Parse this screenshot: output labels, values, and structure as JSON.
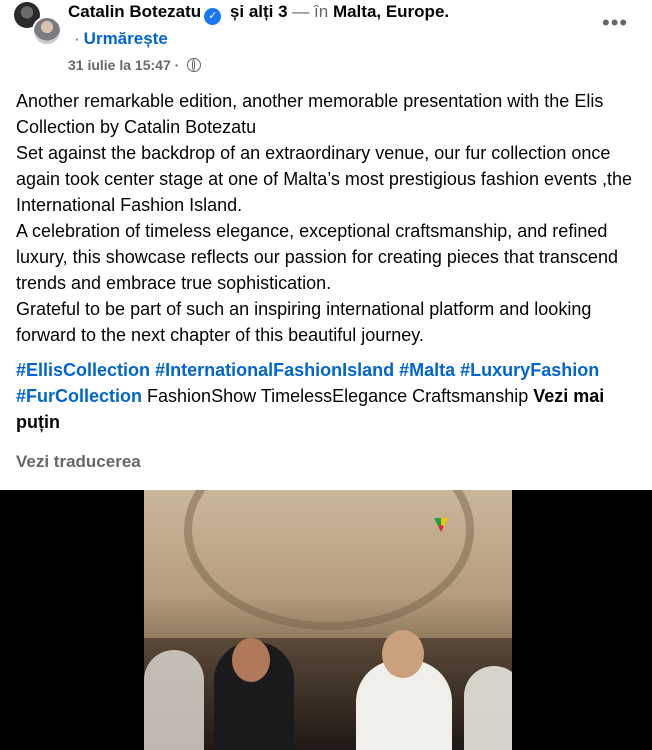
{
  "post": {
    "author": "Catalin Botezatu",
    "coauthors": "și alți 3",
    "location_sep": "— în",
    "location": "Malta, Europe.",
    "follow": "Urmărește",
    "follow_dot": "·",
    "timestamp": "31 iulie la 15:47",
    "meta_dot": "·",
    "more_menu": "•••",
    "paragraphs": [
      "Another remarkable edition, another memorable presentation with the Elis Collection by Catalin Botezatu",
      "Set against the backdrop of an extraordinary venue, our fur collection once again took center stage at one of Malta’s most prestigious fashion events ,the International Fashion Island.",
      "A celebration of timeless elegance, exceptional craftsmanship, and refined luxury, this showcase reflects our passion for creating pieces that transcend trends and embrace true sophistication.",
      "Grateful to be part of such an inspiring international platform and looking forward to the next chapter of this beautiful journey."
    ],
    "hashtags": [
      "#EllisCollection",
      "#InternationalFashionIsland",
      "#Malta",
      "#LuxuryFashion",
      "#FurCollection"
    ],
    "plain_tags": "FashionShow TimelessElegance Craftsmanship",
    "see_less": "Vezi mai puțin",
    "translate": "Vezi traducerea",
    "verified_mark": "✓"
  },
  "colors": {
    "link": "#0064d1",
    "secondary": "#65676b",
    "verified": "#1877f2",
    "media_bg": "#000000"
  },
  "icons": [
    "globe-icon",
    "verified-badge-icon",
    "more-options-icon"
  ]
}
